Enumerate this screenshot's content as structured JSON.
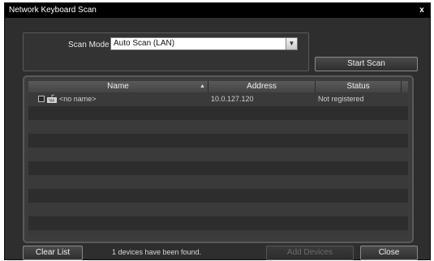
{
  "window": {
    "title": "Network Keyboard Scan",
    "close_glyph": "x"
  },
  "scan": {
    "mode_label": "Scan Mode :",
    "mode_value": "Auto Scan (LAN)",
    "start_button": "Start Scan"
  },
  "table": {
    "columns": {
      "name": "Name",
      "address": "Address",
      "status": "Status"
    },
    "sort_indicator": "ascending",
    "rows": [
      {
        "name": "<no name>",
        "address": "10.0.127.120",
        "status": "Not registered",
        "checked": false,
        "icon": "keyboard-icon"
      }
    ]
  },
  "footer": {
    "clear_button": "Clear List",
    "found_text": "1 devices have been found.",
    "add_button": "Add Devices",
    "close_button": "Close"
  },
  "colors": {
    "background": "#2e2e2e",
    "titlebar": "#000000",
    "row_odd": "#3a3a3a",
    "row_even": "#2d2d2d",
    "text": "#e4e4e4"
  }
}
